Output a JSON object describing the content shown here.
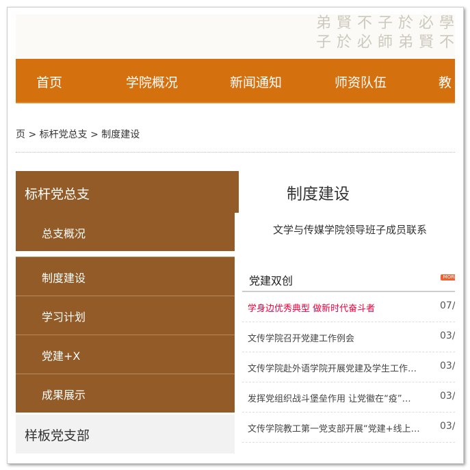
{
  "banner": {
    "text": "學不必賢於弟子師不必賢於弟子"
  },
  "nav": {
    "items": [
      "首页",
      "学院概况",
      "新闻通知",
      "师资队伍",
      "教"
    ]
  },
  "breadcrumb": "页 > 标杆党总支 > 制度建设",
  "sidebar": {
    "header": "标杆党总支",
    "items": [
      "总支概况",
      "制度建设",
      "学习计划",
      "党建+X",
      "成果展示"
    ],
    "next_section": "样板党支部"
  },
  "main": {
    "title": "制度建设",
    "subtitle": "文学与传媒学院领导班子成员联系"
  },
  "news": {
    "header": "党建双创",
    "more_label": "MORE",
    "accent": "#f0003c",
    "items": [
      {
        "title": "学身边优秀典型 做新时代奋斗者",
        "date": "07/",
        "highlight": true
      },
      {
        "title": "文传学院召开党建工作例会",
        "date": "03/"
      },
      {
        "title": "文传学院赴外语学院开展党建及学生工作…",
        "date": "03/"
      },
      {
        "title": "发挥党组织战斗堡垒作用 让党徽在“疫”…",
        "date": "03/"
      },
      {
        "title": "文传学院教工第一党支部开展“党建+线上…",
        "date": "03/"
      }
    ]
  }
}
